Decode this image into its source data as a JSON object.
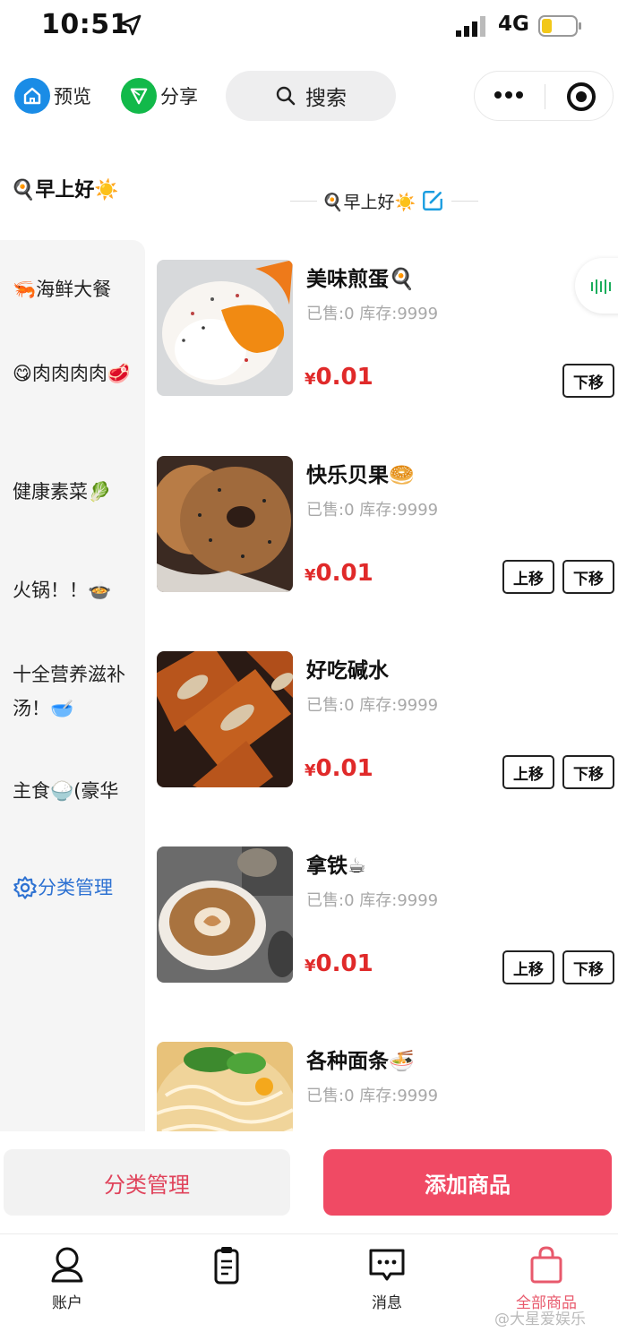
{
  "status_bar": {
    "time": "10:51",
    "network": "4G"
  },
  "top_bar": {
    "preview_label": "预览",
    "share_label": "分享",
    "search_label": "搜索"
  },
  "greeting": {
    "left_text": "🍳早上好☀️",
    "center_text": "🍳早上好☀️"
  },
  "sidebar": {
    "categories": [
      {
        "label": "🦐海鲜大餐"
      },
      {
        "label": "😋肉肉肉肉🥩"
      },
      {
        "label": "健康素菜🥬"
      },
      {
        "label": "火锅！！🍲"
      },
      {
        "label": "十全营养滋补汤！🥣"
      },
      {
        "label": "主食🍚(豪华"
      }
    ],
    "manage_label": "分类管理"
  },
  "products": [
    {
      "name": "美味煎蛋🍳",
      "sold": "已售:0",
      "stock": "库存:9999",
      "currency": "¥",
      "price": "0.01",
      "up_label": "",
      "down_label": "下移"
    },
    {
      "name": "快乐贝果🥯",
      "sold": "已售:0",
      "stock": "库存:9999",
      "currency": "¥",
      "price": "0.01",
      "up_label": "上移",
      "down_label": "下移"
    },
    {
      "name": "好吃碱水",
      "sold": "已售:0",
      "stock": "库存:9999",
      "currency": "¥",
      "price": "0.01",
      "up_label": "上移",
      "down_label": "下移"
    },
    {
      "name": "拿铁☕",
      "sold": "已售:0",
      "stock": "库存:9999",
      "currency": "¥",
      "price": "0.01",
      "up_label": "上移",
      "down_label": "下移"
    },
    {
      "name": "各种面条🍜",
      "sold": "已售:0",
      "stock": "库存:9999"
    }
  ],
  "actions": {
    "category_manage_label": "分类管理",
    "add_product_label": "添加商品"
  },
  "tab_bar": {
    "tabs": [
      {
        "label": "账户"
      },
      {
        "label": ""
      },
      {
        "label": "消息"
      },
      {
        "label": "全部商品"
      }
    ]
  },
  "watermark": "@大星爱娱乐",
  "colors": {
    "price": "#e02a2a",
    "primary_button": "#f04a64",
    "active_tab": "#e8596c",
    "category_manage": "#2e72d2",
    "preview_icon": "#1a8ce6",
    "share_icon": "#12b94a"
  }
}
